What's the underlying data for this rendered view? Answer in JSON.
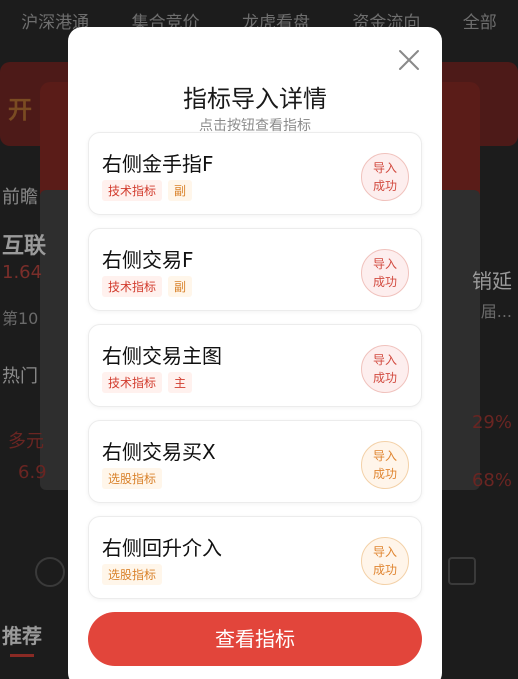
{
  "background": {
    "tabs": [
      "沪深港通",
      "集合竞价",
      "龙虎看盘",
      "资金流向",
      "全部"
    ],
    "left_texts": [
      "开",
      "前瞻",
      "互联",
      "1.64",
      "第10",
      "热门",
      "多元",
      "6.9"
    ],
    "right_texts": [
      "销延",
      "届...",
      "29%",
      "68%"
    ],
    "bottom_tab": "推荐"
  },
  "modal": {
    "title": "指标导入详情",
    "subtitle": "点击按钮查看指标",
    "items": [
      {
        "name": "右侧金手指F",
        "tags": [
          "技术指标",
          "副"
        ],
        "status": [
          "导入",
          "成功"
        ]
      },
      {
        "name": "右侧交易F",
        "tags": [
          "技术指标",
          "副"
        ],
        "status": [
          "导入",
          "成功"
        ]
      },
      {
        "name": "右侧交易主图",
        "tags": [
          "技术指标",
          "主"
        ],
        "status": [
          "导入",
          "成功"
        ]
      },
      {
        "name": "右侧交易买X",
        "tags": [
          "选股指标"
        ],
        "status": [
          "导入",
          "成功"
        ]
      },
      {
        "name": "右侧回升介入",
        "tags": [
          "选股指标"
        ],
        "status": [
          "导入",
          "成功"
        ]
      }
    ],
    "view_button": "查看指标"
  },
  "colors": {
    "accent": "#e2453b",
    "tag_red": "#d23c2e",
    "tag_orange": "#d9822b"
  },
  "icons": {
    "close": "close-icon"
  }
}
